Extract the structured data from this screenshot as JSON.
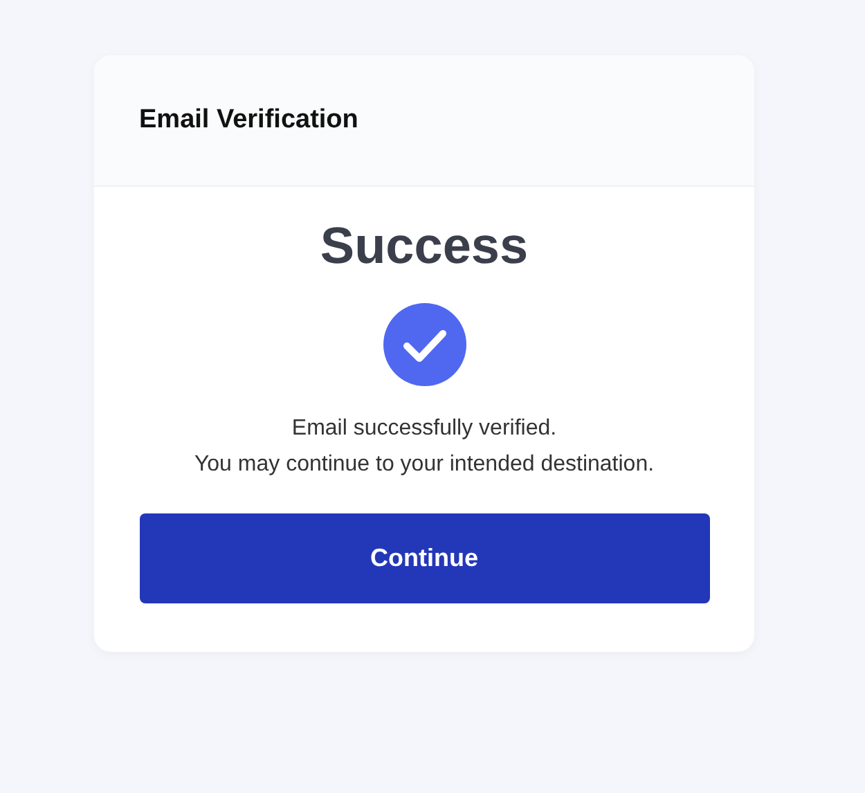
{
  "card": {
    "title": "Email Verification"
  },
  "status": {
    "heading": "Success",
    "messages": [
      "Email successfully verified.",
      "You may continue to your intended destination."
    ]
  },
  "buttons": [
    "Continue"
  ]
}
